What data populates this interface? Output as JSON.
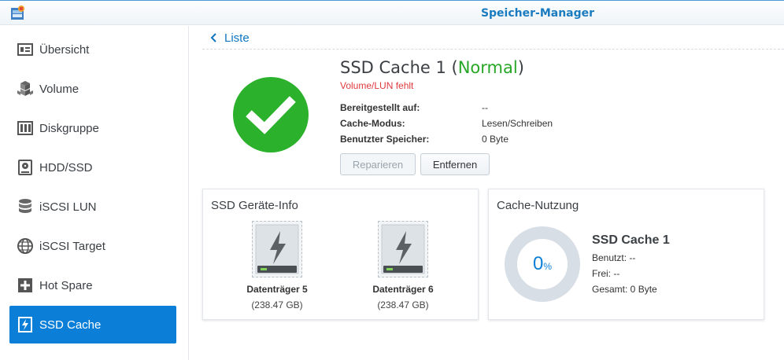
{
  "window": {
    "title": "Speicher-Manager"
  },
  "sidebar": {
    "items": [
      {
        "label": "Übersicht",
        "icon": "overview-icon"
      },
      {
        "label": "Volume",
        "icon": "volume-icon"
      },
      {
        "label": "Diskgruppe",
        "icon": "diskgroup-icon"
      },
      {
        "label": "HDD/SSD",
        "icon": "hdd-icon"
      },
      {
        "label": "iSCSI LUN",
        "icon": "database-icon"
      },
      {
        "label": "iSCSI Target",
        "icon": "globe-icon"
      },
      {
        "label": "Hot Spare",
        "icon": "plus-box-icon"
      },
      {
        "label": "SSD Cache",
        "icon": "ssd-cache-icon",
        "active": true
      }
    ]
  },
  "breadcrumb": {
    "label": "Liste"
  },
  "cache": {
    "name": "SSD Cache 1",
    "title_open": "SSD Cache 1 (",
    "status": "Normal",
    "title_close": ")",
    "warning": "Volume/LUN fehlt",
    "fields": [
      {
        "key": "Bereitgestellt auf:",
        "value": "--"
      },
      {
        "key": "Cache-Modus:",
        "value": "Lesen/Schreiben"
      },
      {
        "key": "Benutzter Speicher:",
        "value": "0 Byte"
      }
    ]
  },
  "actions": {
    "repair": "Reparieren",
    "remove": "Entfernen"
  },
  "ssd_info": {
    "title": "SSD Geräte-Info",
    "disks": [
      {
        "name": "Datenträger 5",
        "sub": "(238.47 GB)"
      },
      {
        "name": "Datenträger 6",
        "sub": "(238.47 GB)"
      }
    ]
  },
  "usage": {
    "title": "Cache-Nutzung",
    "percent": "0",
    "percent_unit": "%",
    "name": "SSD Cache 1",
    "used": "Benutzt: --",
    "free": "Frei: --",
    "total": "Gesamt: 0 Byte"
  },
  "colors": {
    "accent": "#0b7fd7",
    "ok": "#2bb12b",
    "warning": "#e0393e"
  }
}
